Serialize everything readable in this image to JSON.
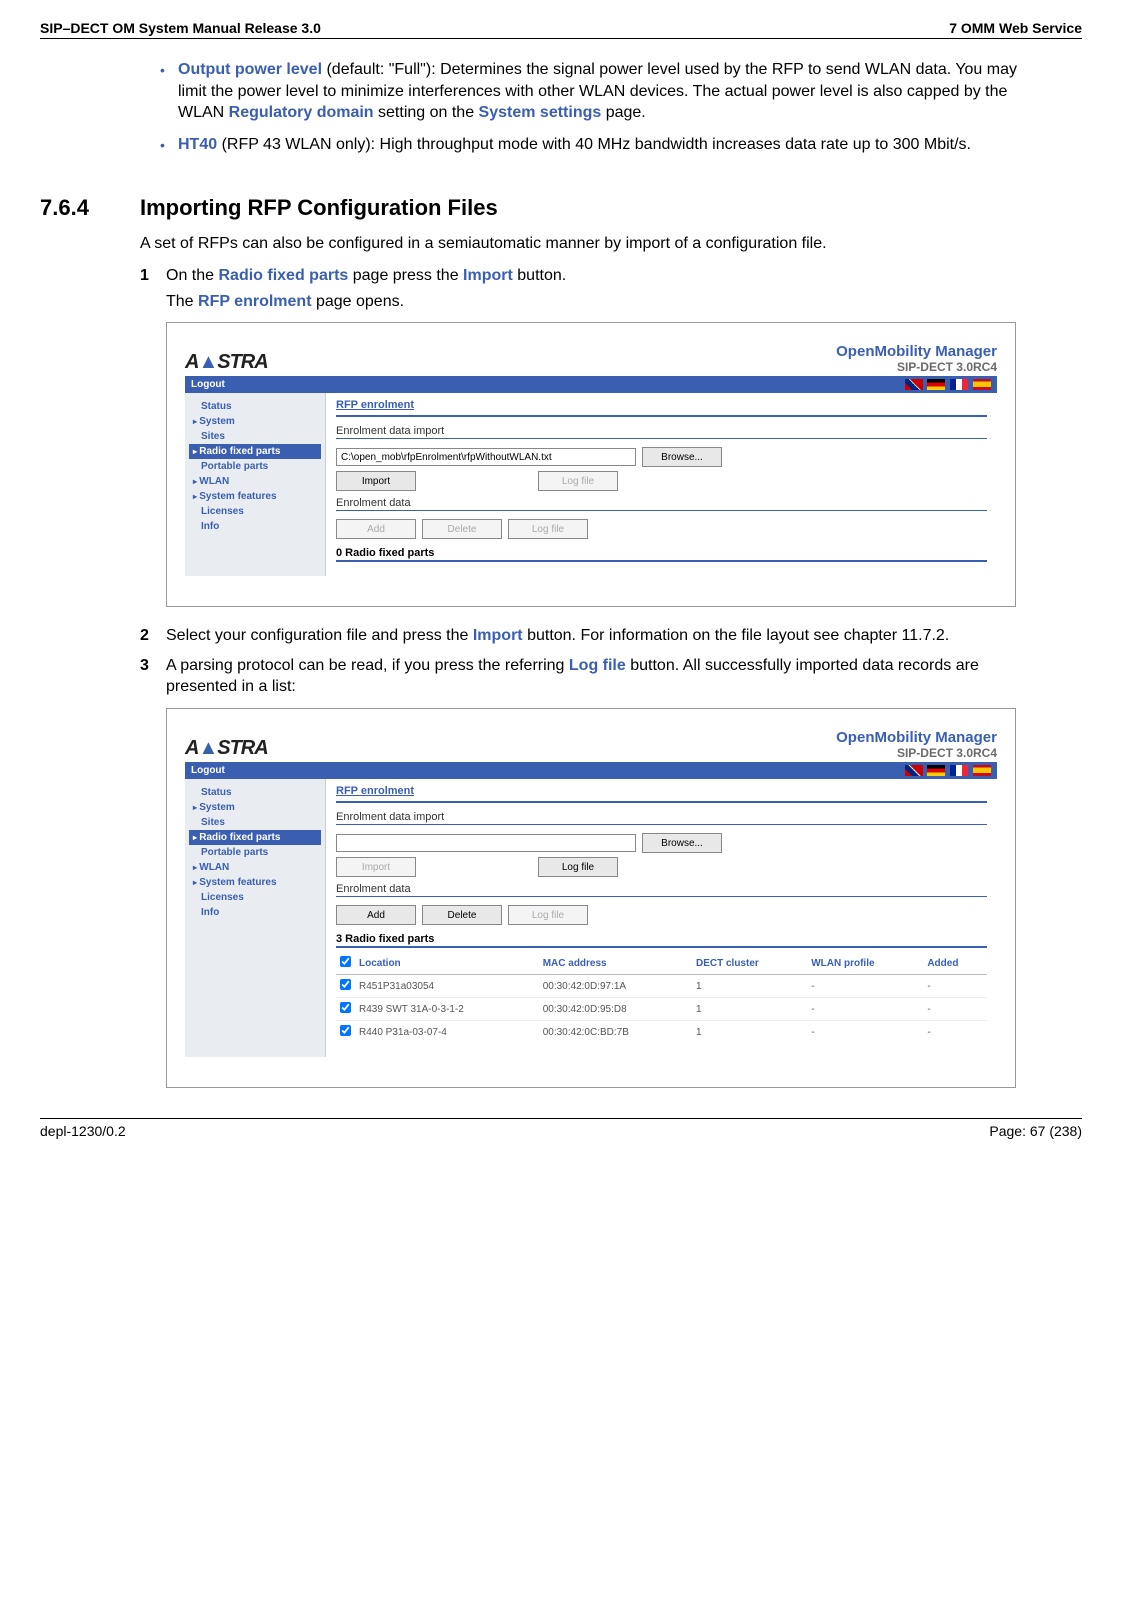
{
  "header": {
    "left": "SIP–DECT OM System Manual Release 3.0",
    "right": "7 OMM Web Service"
  },
  "bullets": [
    {
      "label": "Output power level",
      "text": " (default: \"Full\"): Determines the signal power level used by the RFP to send WLAN data. You may limit the power level to minimize interferences with other WLAN devices. The actual power level is also capped by the WLAN ",
      "trail_label": "Regulatory domain",
      "trail_text": " setting on the ",
      "trail_label2": "System settings",
      "trail_text2": " page."
    },
    {
      "label": "HT40",
      "text": " (RFP 43 WLAN only): High throughput mode with 40 MHz bandwidth increases data rate up to 300 Mbit/s."
    }
  ],
  "section": {
    "num": "7.6.4",
    "title": "Importing RFP Configuration Files"
  },
  "intro": "A set of RFPs can also be configured in a semiautomatic manner by import of a configuration file.",
  "steps": {
    "s1a": "On the ",
    "s1b": "Radio fixed parts",
    "s1c": " page press the ",
    "s1d": "Import",
    "s1e": " button.",
    "s1f": "The ",
    "s1g": "RFP enrolment",
    "s1h": " page opens.",
    "s2a": "Select your configuration file and press the ",
    "s2b": "Import",
    "s2c": " button. For information on the file layout see chapter 11.7.2.",
    "s3a": "A parsing protocol can be read, if you press the referring ",
    "s3b": "Log file",
    "s3c": " button. All successfully imported data records are presented in a list:"
  },
  "ss": {
    "logo_a": "A",
    "logo_tri": "▲",
    "logo_rest": "STRA",
    "title1": "OpenMobility Manager",
    "title2": "SIP-DECT 3.0RC4",
    "logout": "Logout",
    "nav": [
      "Status",
      "System",
      "Sites",
      "Radio fixed parts",
      "Portable parts",
      "WLAN",
      "System features",
      "Licenses",
      "Info"
    ],
    "page_title": "RFP enrolment",
    "sub1": "Enrolment data import",
    "file_value": "C:\\open_mob\\rfpEnrolment\\rfpWithoutWLAN.txt",
    "browse": "Browse...",
    "import": "Import",
    "logfile": "Log file",
    "sub2": "Enrolment data",
    "add": "Add",
    "delete": "Delete",
    "count0": "0 Radio fixed parts",
    "count3": "3 Radio fixed parts",
    "th": {
      "loc": "Location",
      "mac": "MAC address",
      "dect": "DECT cluster",
      "wlan": "WLAN profile",
      "added": "Added"
    },
    "rows": [
      {
        "loc": "R451P31a03054",
        "mac": "00:30:42:0D:97:1A",
        "dect": "1",
        "wlan": "-",
        "added": "-"
      },
      {
        "loc": "R439 SWT 31A-0-3-1-2",
        "mac": "00:30:42:0D:95:D8",
        "dect": "1",
        "wlan": "-",
        "added": "-"
      },
      {
        "loc": "R440 P31a-03-07-4",
        "mac": "00:30:42:0C:BD:7B",
        "dect": "1",
        "wlan": "-",
        "added": "-"
      }
    ]
  },
  "footer": {
    "left": "depl-1230/0.2",
    "right": "Page: 67 (238)"
  }
}
